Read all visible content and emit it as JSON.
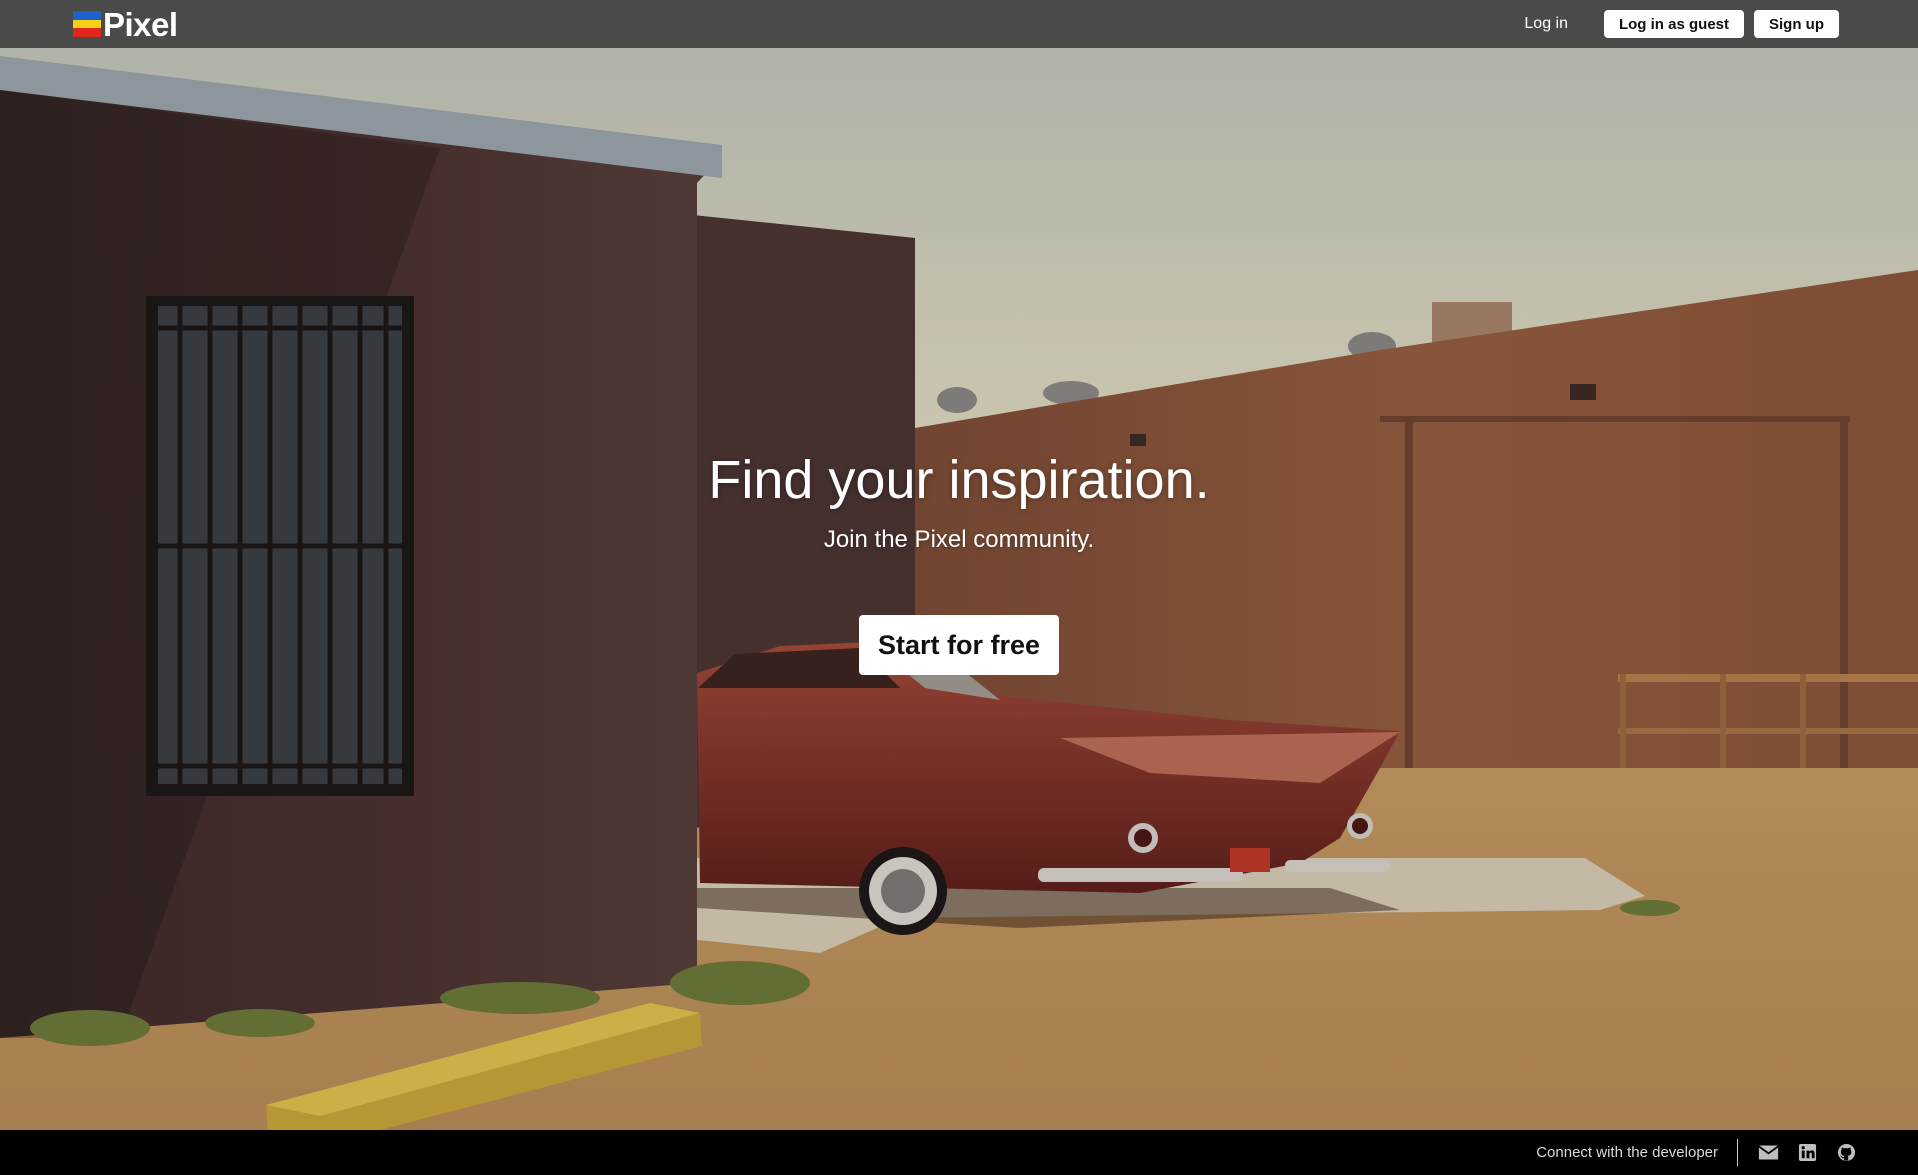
{
  "brand": {
    "name": "Pixel",
    "logo_stripe_colors": [
      "#1e62c9",
      "#f4d019",
      "#e3261b"
    ]
  },
  "header": {
    "login_label": "Log in",
    "guest_login_label": "Log in as guest",
    "signup_label": "Sign up"
  },
  "hero": {
    "title": "Find your inspiration.",
    "subtitle": "Join the Pixel community.",
    "cta_label": "Start for free",
    "background_scene": "vintage-red-car-parked-beside-adobe-buildings"
  },
  "footer": {
    "connect_label": "Connect with the developer",
    "icons": [
      "mail-icon",
      "linkedin-icon",
      "github-icon"
    ]
  },
  "colors": {
    "header_bg": "#4a4a48",
    "footer_bg": "#000000",
    "button_bg": "#ffffff",
    "button_text": "#111111"
  }
}
